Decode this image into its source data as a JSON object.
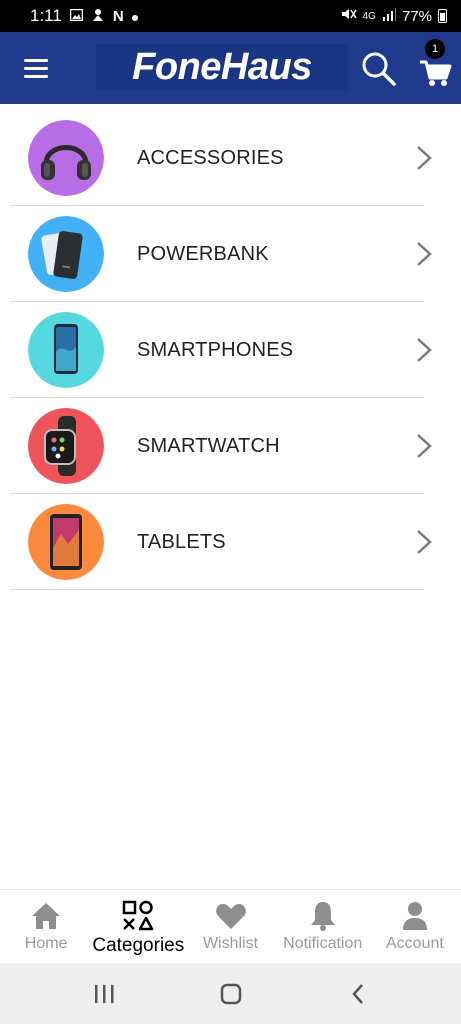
{
  "status_bar": {
    "time": "1:11",
    "left_icons": [
      "image-icon",
      "app-notification-icon",
      "netflix-icon",
      "dot-icon"
    ],
    "network": "4G",
    "battery": "77%",
    "battery_level": 0.77
  },
  "app_bar": {
    "logo_text": "FoneHaus",
    "background_color": "#1f3a8c",
    "cart_count": "1",
    "icons": [
      "menu-icon",
      "search-icon",
      "cart-icon"
    ]
  },
  "categories": [
    {
      "label": "ACCESSORIES",
      "circle_color": "#b86de6",
      "image": "headphones-icon"
    },
    {
      "label": "POWERBANK",
      "circle_color": "#42b0f5",
      "image": "powerbank-icon"
    },
    {
      "label": "SMARTPHONES",
      "circle_color": "#55d8df",
      "image": "smartphone-icon"
    },
    {
      "label": "SMARTWATCH",
      "circle_color": "#f0545b",
      "image": "smartwatch-icon"
    },
    {
      "label": "TABLETS",
      "circle_color": "#fb8a3e",
      "image": "tablet-icon"
    }
  ],
  "bottom_nav": {
    "items": [
      {
        "label": "Home",
        "icon": "home-icon",
        "active": false
      },
      {
        "label": "Categories",
        "icon": "categories-icon",
        "active": true
      },
      {
        "label": "Wishlist",
        "icon": "heart-icon",
        "active": false
      },
      {
        "label": "Notification",
        "icon": "bell-icon",
        "active": false
      },
      {
        "label": "Account",
        "icon": "person-icon",
        "active": false
      }
    ]
  },
  "system_nav": [
    "recents-icon",
    "home-button-icon",
    "back-icon"
  ]
}
